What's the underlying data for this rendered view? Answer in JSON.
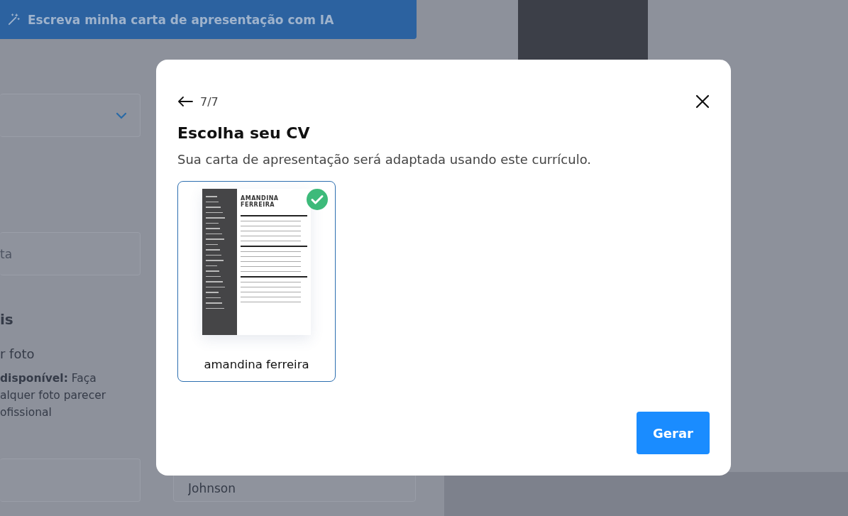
{
  "background_page": {
    "ai_button": {
      "label": "Escreva minha carta de apresentação com IA"
    },
    "text_field": {
      "placeholder": "ta"
    },
    "section_heading": "is",
    "photo_label": "r foto",
    "photo_note_lines": [
      "**disponível:** Faça",
      "alquer foto parecer",
      "ofissional"
    ],
    "last_name_field": {
      "value": "Johnson"
    }
  },
  "modal": {
    "step": "7/7",
    "title": "Escolha seu CV",
    "subtitle": "Sua carta de apresentação será adaptada usando este currículo.",
    "resumes": [
      {
        "name": "amandina ferreira",
        "selected": true,
        "preview_heading": [
          "AMANDINA",
          "FERREIRA"
        ]
      }
    ],
    "primary_button": "Gerar"
  }
}
